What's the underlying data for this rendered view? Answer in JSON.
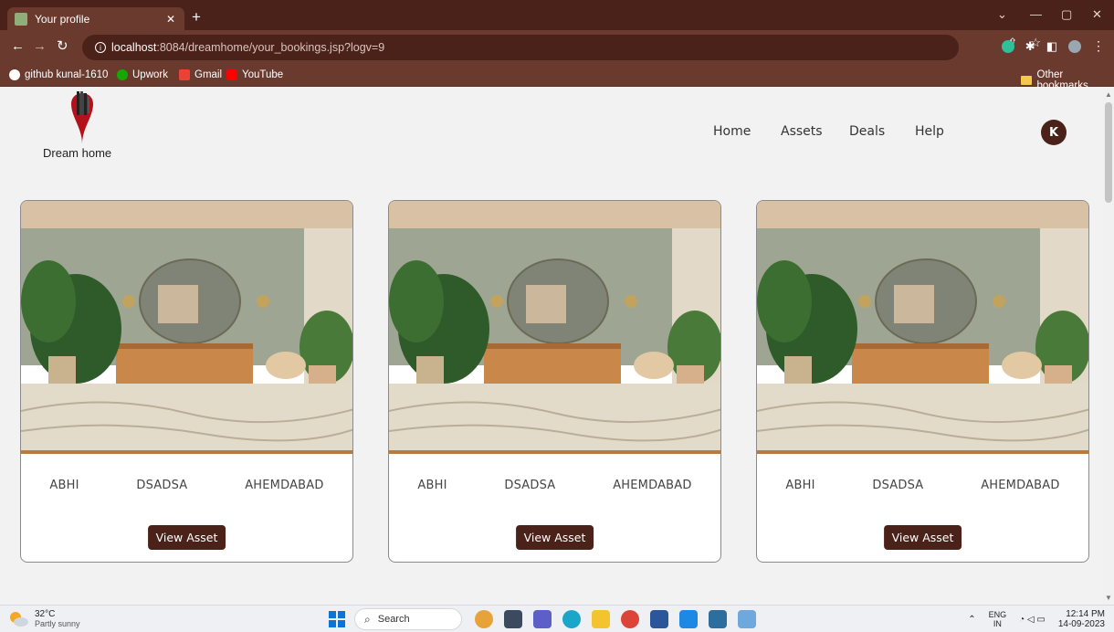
{
  "browser": {
    "tab_title": "Your profile",
    "url_host": "localhost",
    "url_path": ":8084/dreamhome/your_bookings.jsp?logv=9",
    "bookmarks": [
      "github kunal-1610",
      "Upwork",
      "Gmail",
      "YouTube"
    ],
    "other_bookmarks": "Other bookmarks"
  },
  "site": {
    "logo_text": "Dream home",
    "nav": [
      "Home",
      "Assets",
      "Deals",
      "Help"
    ],
    "avatar_initial": "K",
    "accent_color": "#4b2219"
  },
  "cards": [
    {
      "owner": "ABHI",
      "name": "DSADSA",
      "city": "AHEMDABAD",
      "button": "View Asset"
    },
    {
      "owner": "ABHI",
      "name": "DSADSA",
      "city": "AHEMDABAD",
      "button": "View Asset"
    },
    {
      "owner": "ABHI",
      "name": "DSADSA",
      "city": "AHEMDABAD",
      "button": "View Asset"
    }
  ],
  "taskbar": {
    "temperature": "32°C",
    "weather": "Partly sunny",
    "search": "Search",
    "lang_top": "ENG",
    "lang_bottom": "IN",
    "time": "12:14 PM",
    "date": "14-09-2023"
  }
}
